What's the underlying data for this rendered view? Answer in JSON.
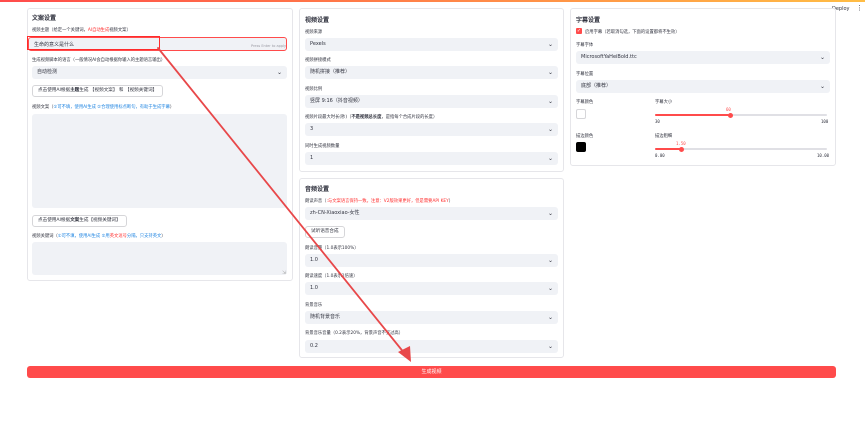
{
  "header": {
    "deploy_label": "Deploy",
    "menu_icon": "more-vert-icon"
  },
  "left": {
    "title": "文案设置",
    "topic_label_pre": "视频主题（给定一个关键词，",
    "topic_label_red": "AI自动生成",
    "topic_label_post": "视频文案）",
    "topic_value": "生命的意义是什么",
    "topic_hint": "Press Enter to apply",
    "lang_label": "生成视频脚本的语言（一般情况AI会自动根据你输入的主题语言输出）",
    "lang_value": "自动检测",
    "gen_script_btn_pre": "点击使用AI根据",
    "gen_script_btn_bold": "主题",
    "gen_script_btn_post": "生成 【视频文案】 和 【视频关键词】",
    "script_label_pre": "视频文案（",
    "script_label_blue": "①可不填，使用AI生成  ②合理使用标点断句，有助于生成字幕",
    "script_label_post": "）",
    "gen_kw_btn_pre": "点击使用AI根据",
    "gen_kw_btn_bold": "文案",
    "gen_kw_btn_post": "生成【视频关键词】",
    "kw_label_pre": "视频关键词（",
    "kw_label_blue": "①可不填，使用AI生成 ②用",
    "kw_label_red": "英文逗号",
    "kw_label_blue2": "分隔，只支持英文",
    "kw_label_post": "）"
  },
  "middle": {
    "video_title": "视频设置",
    "source_label": "视频来源",
    "source_value": "Pexels",
    "concat_label": "视频拼接模式",
    "concat_value": "随机拼接（推荐）",
    "ratio_label": "视频比例",
    "ratio_value": "竖屏 9:16（抖音视频）",
    "clip_label_pre": "视频片段最大时长(秒)（",
    "clip_label_bold": "不是视频总长度",
    "clip_label_post": "，是指每个合成片段的长度）",
    "clip_value": "3",
    "count_label": "同时生成视频数量",
    "count_value": "1",
    "audio_title": "音频设置",
    "voice_label_pre": "朗读声音（",
    "voice_label_red": ":与文案语言保持一致。",
    "voice_label_red2": "注意：V2版效果更好，但是需要API KEY",
    "voice_label_post": "）",
    "voice_value": "zh-CN-XiaoxiaoNeural-Female",
    "voice_value_display": "zh-CN-Xiaoxiao-女性",
    "test_btn": "试听语音合成",
    "volume_label": "朗读音量（1.0表示100%）",
    "volume_value": "1.0",
    "rate_label": "朗读速度（1.0表示1倍速）",
    "rate_value": "1.0",
    "bgm_label": "背景音乐",
    "bgm_value": "随机背景音乐",
    "bgm_vol_label": "背景音乐音量（0.2表示20%，背景声音不宜过高）",
    "bgm_vol_value": "0.2"
  },
  "right": {
    "title": "字幕设置",
    "enable_label": "启用字幕（若取消勾选，下面的设置都将不生效）",
    "font_label": "字幕字体",
    "font_value": "MicrosoftYaHeiBold.ttc",
    "pos_label": "字幕位置",
    "pos_value": "底部（推荐）",
    "font_color_label": "字幕颜色",
    "font_color": "#ffffff",
    "size_label": "字幕大小",
    "size_value": "60",
    "size_min": "30",
    "size_max": "100",
    "stroke_color_label": "描边颜色",
    "stroke_color": "#000000",
    "stroke_label": "描边粗细",
    "stroke_value": "1.50",
    "stroke_min": "0.00",
    "stroke_max": "10.00"
  },
  "generate_btn": "生成视频",
  "accent_color": "#ff4b4b"
}
